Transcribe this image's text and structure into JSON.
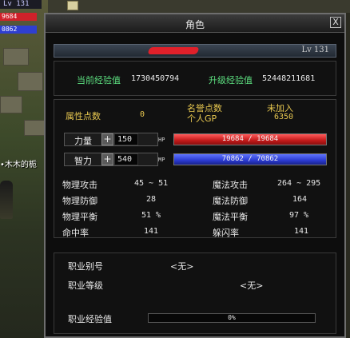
{
  "hud": {
    "level": "Lv 131",
    "hp_short": "9684",
    "mp_short": "0862",
    "npc_name": "•木木的栀"
  },
  "window": {
    "title": "角色",
    "close_label": "X"
  },
  "character": {
    "level": "Lv 131"
  },
  "experience": {
    "current_label": "当前经验值",
    "current_value": "1730450794",
    "next_label": "升级经验值",
    "next_value": "52448211681"
  },
  "attributes": {
    "points_label": "属性点数",
    "points_value": "0",
    "fame_label": "名誉点数",
    "fame_value": "未加入",
    "gp_label": "个人GP",
    "gp_value": "6350",
    "strength": {
      "label": "力量",
      "value": "150",
      "bar_tag": "HP",
      "bar_text": "19684 / 19684",
      "fill_fraction": 1.0
    },
    "intellect": {
      "label": "智力",
      "value": "540",
      "bar_tag": "MP",
      "bar_text": "70862 / 70862",
      "fill_fraction": 1.0
    },
    "plus_label": "+"
  },
  "combat": {
    "left": [
      {
        "label": "物理攻击",
        "value": "45 ~ 51"
      },
      {
        "label": "物理防御",
        "value": "28"
      },
      {
        "label": "物理平衡",
        "value": "51 %"
      },
      {
        "label": "命中率",
        "value": "141"
      }
    ],
    "right": [
      {
        "label": "魔法攻击",
        "value": "264 ~ 295"
      },
      {
        "label": "魔法防御",
        "value": "164"
      },
      {
        "label": "魔法平衡",
        "value": "97 %"
      },
      {
        "label": "躲闪率",
        "value": "141"
      }
    ]
  },
  "job": {
    "type_label": "职业别号",
    "type_value": "<无>",
    "level_label": "职业等级",
    "level_value": "<无>",
    "exp_label": "职业经验值",
    "exp_value": "0%",
    "exp_fraction": 0
  },
  "colors": {
    "label_green": "#5de080",
    "label_yellow": "#e8c850",
    "hp_red": "#c21a1a",
    "mp_blue": "#2a3ad0"
  }
}
